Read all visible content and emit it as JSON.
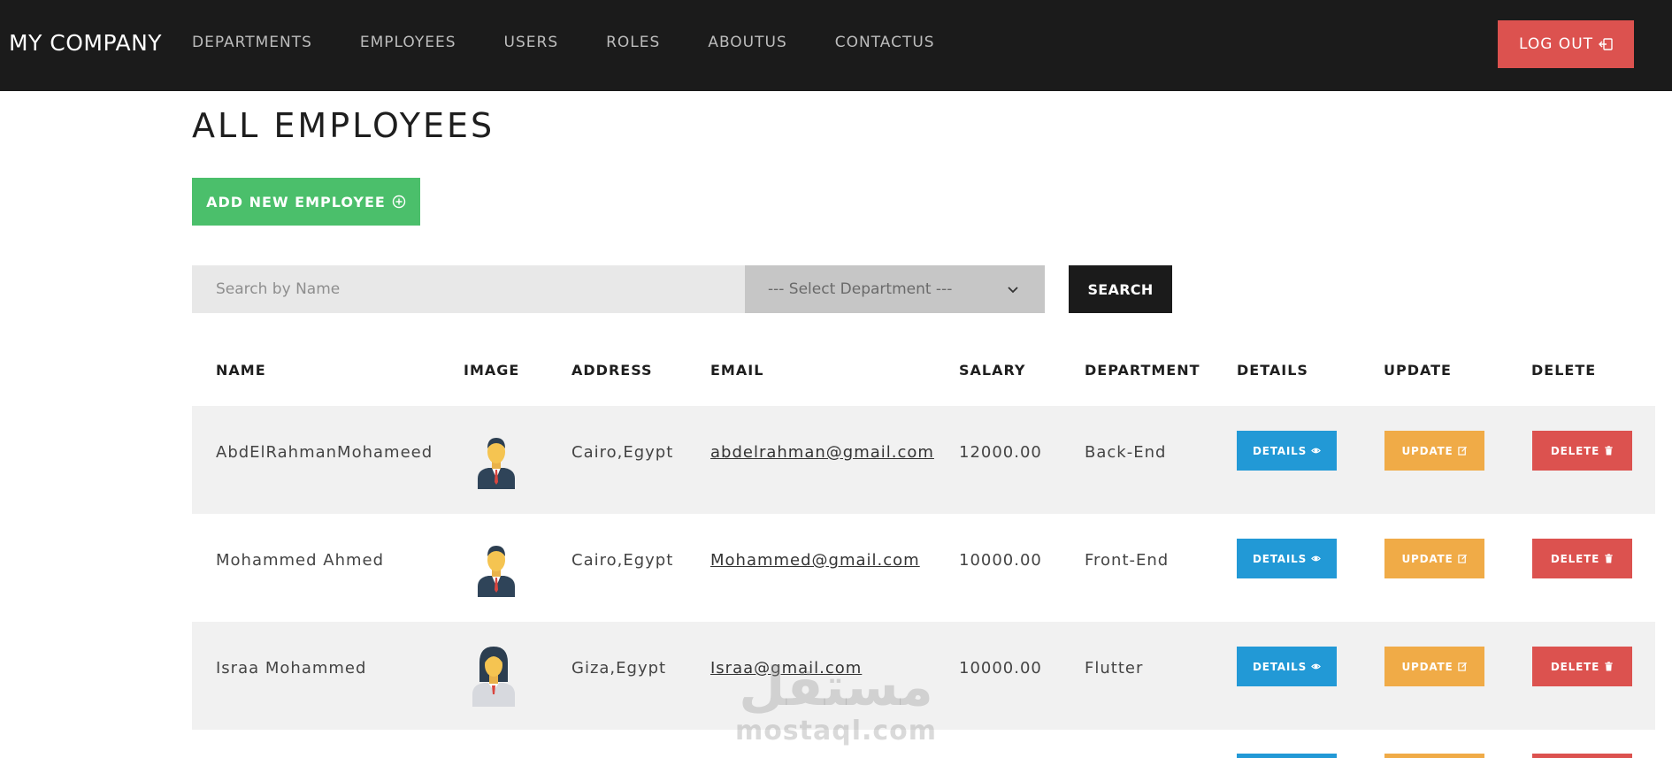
{
  "navbar": {
    "brand": "MY COMPANY",
    "links": [
      "DEPARTMENTS",
      "EMPLOYEES",
      "USERS",
      "ROLES",
      "ABOUTUS",
      "CONTACTUS"
    ],
    "logout_label": "LOG OUT",
    "logout_icon": "sign-out-icon"
  },
  "page": {
    "title": "ALL EMPLOYEES",
    "add_label": "ADD NEW EMPLOYEE",
    "add_icon": "plus-circle-icon"
  },
  "search": {
    "placeholder": "Search by Name",
    "value": "",
    "department_selected": "--- Select Department ---",
    "button_label": "SEARCH"
  },
  "table": {
    "headers": [
      "NAME",
      "IMAGE",
      "ADDRESS",
      "EMAIL",
      "SALARY",
      "DEPARTMENT",
      "DETAILS",
      "UPDATE",
      "DELETE"
    ],
    "rows": [
      {
        "name": "AbdElRahmanMohameed",
        "avatar": "male-avatar-icon",
        "address": "Cairo,Egypt",
        "email": "abdelrahman@gmail.com",
        "salary": "12000.00",
        "department": "Back-End"
      },
      {
        "name": "Mohammed Ahmed",
        "avatar": "male-avatar-icon",
        "address": "Cairo,Egypt",
        "email": "Mohammed@gmail.com",
        "salary": "10000.00",
        "department": "Front-End"
      },
      {
        "name": "Israa Mohammed",
        "avatar": "female-avatar-icon",
        "address": "Giza,Egypt",
        "email": "Israa@gmail.com",
        "salary": "10000.00",
        "department": "Flutter"
      }
    ],
    "details_label": "DETAILS",
    "update_label": "UPDATE",
    "delete_label": "DELETE"
  },
  "watermark": {
    "arabic": "مستقل",
    "latin": "mostaql.com"
  },
  "colors": {
    "navbar": "#1b1b1b",
    "logout": "#dc524f",
    "add": "#4bbf6b",
    "details": "#2299d6",
    "update": "#f0ab47",
    "delete": "#dc524f"
  }
}
